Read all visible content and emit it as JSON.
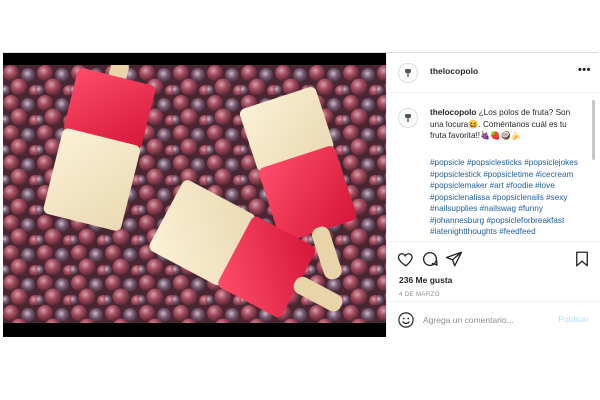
{
  "post": {
    "username": "thelocopolo",
    "more_label": "•••",
    "caption": {
      "username": "thelocopolo",
      "text": "¿Los polos de fruta? Son una locura😆. Coméntanos cuál es tu fruta favorita!!🍇🍓🥥🍌",
      "hashtags": [
        "#popsicle",
        "#popsiclesticks",
        "#popsiclejokes",
        "#popsiclestick",
        "#popsicletime",
        "#icecream",
        "#popsiclemaker",
        "#art",
        "#foodie",
        "#love",
        "#popsiclenalissa",
        "#popsiclenails",
        "#sexy",
        "#nailsupplies",
        "#nailswag",
        "#funny",
        "#johannesburg",
        "#popsicleforbreakfast",
        "#latenightthoughts",
        "#feedfeed"
      ]
    },
    "likes": "236 Me gusta",
    "date": "4 DE MARZO",
    "comment": {
      "placeholder": "Agrega un comentario...",
      "publish_label": "Publicar"
    }
  },
  "icons": {
    "like": "heart-icon",
    "comment": "comment-bubble-icon",
    "share": "paper-plane-icon",
    "save": "bookmark-icon",
    "emoji": "smiley-icon",
    "more": "more-options-icon"
  },
  "colors": {
    "hashtag": "#1d5f9f",
    "publish": "#b2dffc",
    "muted": "#8e8e8e",
    "text": "#262626"
  }
}
